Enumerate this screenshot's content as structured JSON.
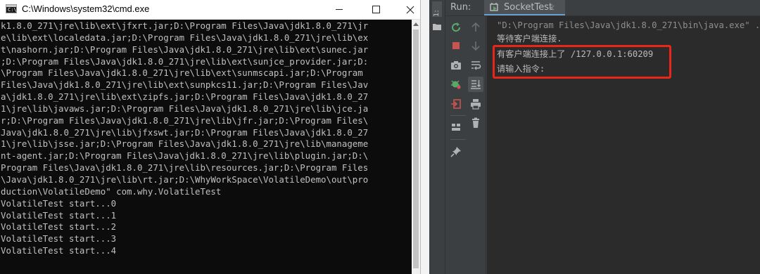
{
  "cmd": {
    "title": "C:\\Windows\\system32\\cmd.exe",
    "icon_label": "C:\\",
    "lines": [
      "k1.8.0_271\\jre\\lib\\ext\\jfxrt.jar;D:\\Program Files\\Java\\jdk1.8.0_271\\jr",
      "e\\lib\\ext\\localedata.jar;D:\\Program Files\\Java\\jdk1.8.0_271\\jre\\lib\\ex",
      "t\\nashorn.jar;D:\\Program Files\\Java\\jdk1.8.0_271\\jre\\lib\\ext\\sunec.jar",
      ";D:\\Program Files\\Java\\jdk1.8.0_271\\jre\\lib\\ext\\sunjce_provider.jar;D:",
      "\\Program Files\\Java\\jdk1.8.0_271\\jre\\lib\\ext\\sunmscapi.jar;D:\\Program",
      "Files\\Java\\jdk1.8.0_271\\jre\\lib\\ext\\sunpkcs11.jar;D:\\Program Files\\Jav",
      "a\\jdk1.8.0_271\\jre\\lib\\ext\\zipfs.jar;D:\\Program Files\\Java\\jdk1.8.0_27",
      "1\\jre\\lib\\javaws.jar;D:\\Program Files\\Java\\jdk1.8.0_271\\jre\\lib\\jce.ja",
      "r;D:\\Program Files\\Java\\jdk1.8.0_271\\jre\\lib\\jfr.jar;D:\\Program Files\\",
      "Java\\jdk1.8.0_271\\jre\\lib\\jfxswt.jar;D:\\Program Files\\Java\\jdk1.8.0_27",
      "1\\jre\\lib\\jsse.jar;D:\\Program Files\\Java\\jdk1.8.0_271\\jre\\lib\\manageme",
      "nt-agent.jar;D:\\Program Files\\Java\\jdk1.8.0_271\\jre\\lib\\plugin.jar;D:\\",
      "Program Files\\Java\\jdk1.8.0_271\\jre\\lib\\resources.jar;D:\\Program Files",
      "\\Java\\jdk1.8.0_271\\jre\\lib\\rt.jar;D:\\WhyWorkSpace\\VolatileDemo\\out\\pro",
      "duction\\VolatileDemo\" com.why.VolatileTest",
      "VolatileTest start...0",
      "VolatileTest start...1",
      "VolatileTest start...2",
      "VolatileTest start...3",
      "VolatileTest start...4"
    ]
  },
  "ide": {
    "stripe_label": "1: Pr",
    "run_label": "Run:",
    "tab_title": "SocketTest",
    "tab_close": "×",
    "console": {
      "command": "\"D:\\Program Files\\Java\\jdk1.8.0_271\\bin\\java.exe\" ...",
      "line1": "等待客户端连接.",
      "line2": "有客户端连接上了 /127.0.0.1:60209",
      "line3": "请输入指令:"
    }
  }
}
